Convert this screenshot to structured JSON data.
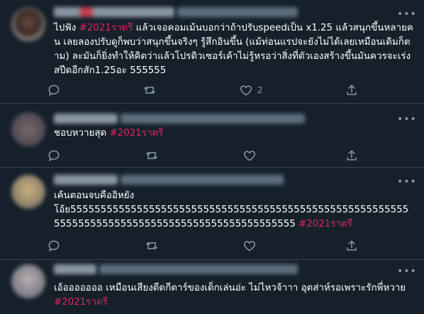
{
  "tweets": [
    {
      "text": "ไปฟัง ",
      "hashtag": "#2021ราตรี",
      "text_after": " แล้วเจอคอมเม้นบอกว่าถ้าปรับspeedเป็น x1.25 แล้วสนุกขึ้นหลายคน เลยลองปรับดูก็พบว่าสนุกขึ้นจริงๆ รู้สึกอินขึ้น (แม้ท่อนแรปจะยังไม่ได้เลยเหมือนเดิมก็ตาม) ละมันก็ยิ่งทำให้คิดว่าแล้วโปรดิวเซอร์เค้าไม่รู้หรอว่าสิ่งที่ตัวเองสร้างขึ้นมันควรจะเร่งสปีดอีกสัก1.25อะ 555555",
      "like_count": "2"
    },
    {
      "text": "ชอบหวายสุด ",
      "hashtag": "#2021ราตรี",
      "text_after": "",
      "like_count": ""
    },
    {
      "text": "เค้นตอนจบคืออิหยัง\nโอ้ย555555555555555555555555555555555555555555555555555555555555555555555555555555555555555555555555 ",
      "hashtag": "#2021ราตรี",
      "text_after": "",
      "like_count": ""
    },
    {
      "text": "เอ้อออออออ เหมือนเสียงตีดกีตาร์ของเด็กเล่นอ่ะ ไม่ไหวจ้าาา อุตส่าห์รอเพราะรักพี่หวาย ",
      "hashtag": "#2021ราตรี",
      "text_after": "",
      "like_count": ""
    }
  ],
  "icons": {
    "reply": "reply-icon",
    "retweet": "retweet-icon",
    "like": "like-icon",
    "share": "share-icon",
    "more": "more-icon"
  },
  "colors": {
    "background": "#15202b",
    "hashtag": "#e0245e",
    "muted": "#8899a6",
    "divider": "#38444d"
  }
}
